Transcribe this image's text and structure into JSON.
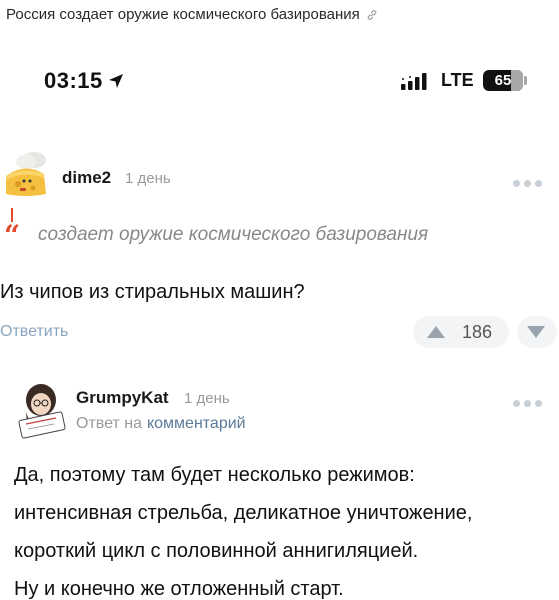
{
  "post": {
    "title": "Россия создает оружие космического базирования"
  },
  "status_bar": {
    "time": "03:15",
    "network": "LTE",
    "battery": "65"
  },
  "comment1": {
    "author": "dime2",
    "date": "1 день",
    "quote": "создает оружие космического базирования",
    "text": "Из чипов из стиральных машин?",
    "reply_label": "Ответить",
    "score": "186"
  },
  "comment2": {
    "author": "GrumpyKat",
    "date": "1 день",
    "reply_prefix": "Ответ на",
    "reply_target": "комментарий",
    "lines": [
      "Да, поэтому там будет несколько режимов:",
      "интенсивная стрельба, деликатное уничтожение,",
      "короткий цикл с половинной аннигиляцией.",
      "Ну и конечно же отложенный старт."
    ]
  },
  "colors": {
    "accent": "#e14b2a",
    "reply_link": "#8aa5bf",
    "muted": "#9a9a9a"
  }
}
